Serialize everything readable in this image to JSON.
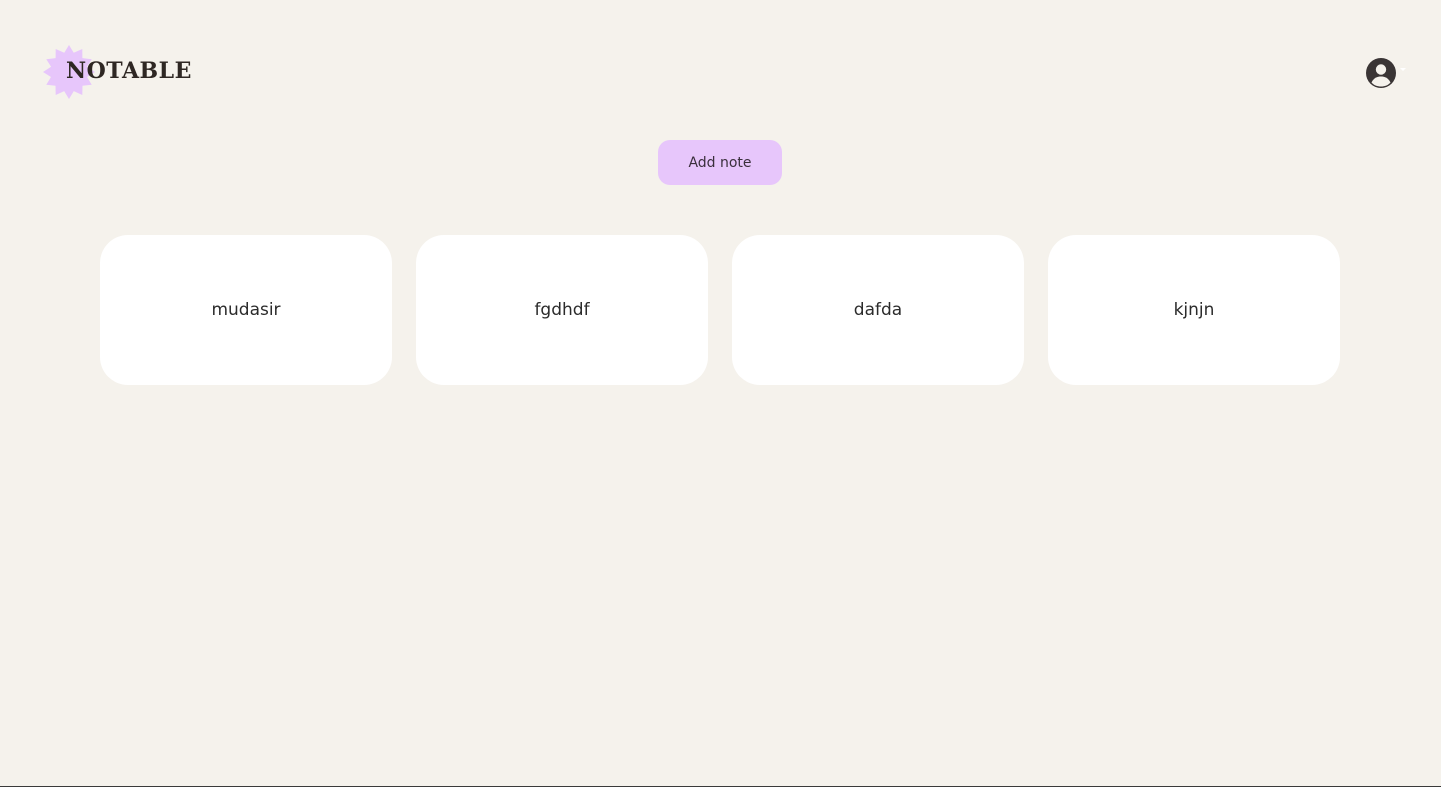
{
  "app": {
    "logo_text": "NOTABLE",
    "colors": {
      "background": "#f5f2ec",
      "accent": "#e7c6fb",
      "card": "#ffffff",
      "text": "#2e2723"
    }
  },
  "header": {
    "account_icon": "user-circle-icon",
    "caret_icon": "chevron-down-icon"
  },
  "toolbar": {
    "add_note_label": "Add note"
  },
  "notes": [
    {
      "title": "mudasir"
    },
    {
      "title": "fgdhdf"
    },
    {
      "title": "dafda"
    },
    {
      "title": "kjnjn"
    }
  ]
}
